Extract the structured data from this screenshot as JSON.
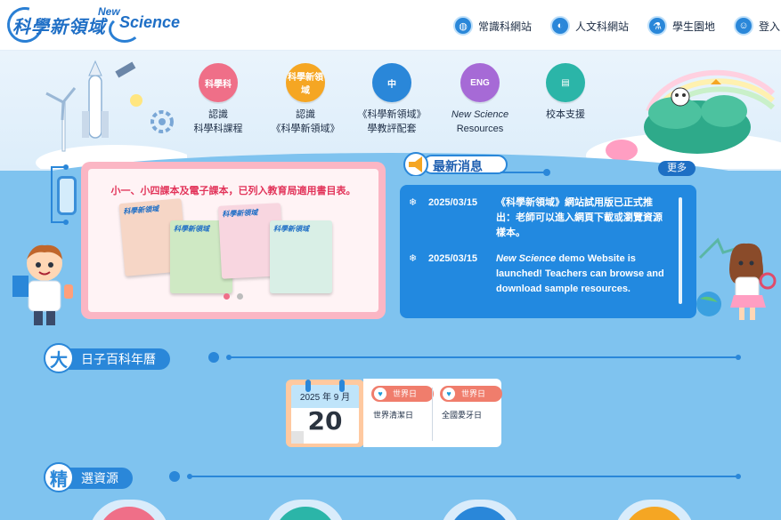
{
  "header": {
    "logo_cn": "科學新領域",
    "logo_en_new": "New",
    "logo_en_science": "Science",
    "links": [
      {
        "label": "常識科網站",
        "icon": "globe-icon"
      },
      {
        "label": "人文科網站",
        "icon": "hand-globe-icon"
      },
      {
        "label": "學生園地",
        "icon": "flask-icon"
      },
      {
        "label": "登入",
        "icon": "robot-icon"
      }
    ]
  },
  "nav": {
    "items": [
      {
        "line1": "認識",
        "line2": "科學科課程",
        "badge": "科學科",
        "icon": "magnifier-icon",
        "color": "#ef6f88"
      },
      {
        "line1": "認識",
        "line2": "《科學新領域》",
        "badge": "科學新領域",
        "icon": "book-icon",
        "color": "#f5a623"
      },
      {
        "line1": "《科學新領域》",
        "line2": "學教評配套",
        "badge": "中",
        "icon": "presentation-icon",
        "color": "#2a87d9"
      },
      {
        "line1": "New Science",
        "line2": "Resources",
        "badge": "ENG",
        "icon": "presentation-icon",
        "color": "#a66ad6"
      },
      {
        "line1": "校本支援",
        "line2": "",
        "badge": "",
        "icon": "clipboard-icon",
        "color": "#2bb5a8"
      }
    ]
  },
  "carousel": {
    "banner": "小一、小四課本及電子課本，已列入教育局適用書目表。",
    "book_title": "科學新領域",
    "slides": 2,
    "active_slide": 0
  },
  "news": {
    "title": "最新消息",
    "more_label": "更多",
    "items": [
      {
        "date": "2025/03/15",
        "text": "《科學新領域》網站試用版已正式推出：老師可以進入網頁下載或瀏覽資源樣本。"
      },
      {
        "date": "2025/03/15",
        "text_italic": "New Science",
        "text": " demo Website is launched! Teachers can browse and download sample resources."
      }
    ]
  },
  "almanac": {
    "badge": "大",
    "title": "日子百科年曆",
    "calendar_month": "2025 年 9 月",
    "calendar_day": "20",
    "days": [
      {
        "tag": "世界日",
        "name": "世界清潔日"
      },
      {
        "tag": "世界日",
        "name": "全國愛牙日"
      }
    ]
  },
  "resources_section": {
    "badge": "精",
    "title": "選資源"
  },
  "colors": {
    "primary": "#2a87d9",
    "background": "#7fc3ef",
    "news_box": "#2289e0",
    "carousel_border": "#fbb6c4",
    "tag": "#f07d6c"
  }
}
